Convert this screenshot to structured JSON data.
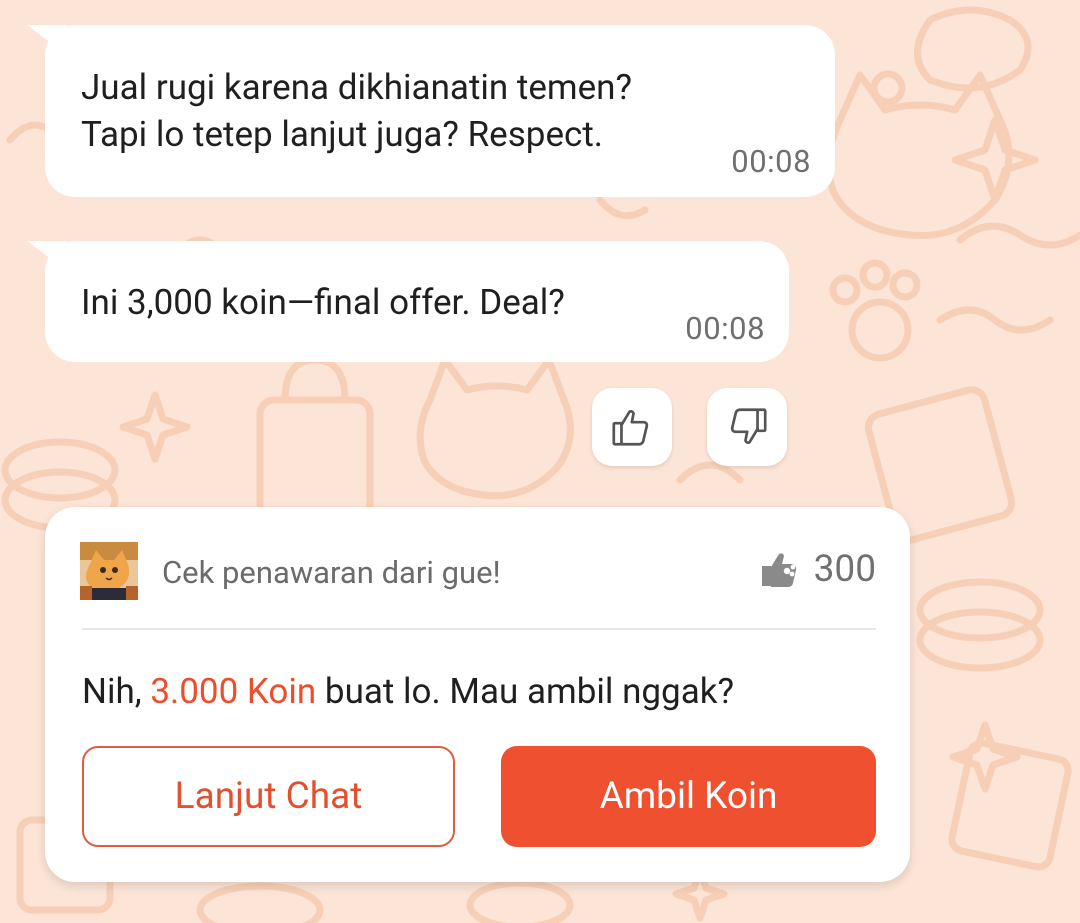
{
  "messages": [
    {
      "text": "Jual rugi karena dikhianatin temen?\nTapi lo tetep lanjut juga? Respect.",
      "time": "00:08"
    },
    {
      "text": "Ini 3,000 koin—final offer. Deal?",
      "time": "00:08"
    }
  ],
  "feedback": {
    "like_icon": "thumbs-up-icon",
    "dislike_icon": "thumbs-down-icon"
  },
  "offer_card": {
    "header": "Cek penawaran dari gue!",
    "count": "300",
    "message_prefix": "Nih, ",
    "message_highlight": "3.000 Koin",
    "message_suffix": " buat lo. Mau ambil nggak?",
    "secondary_button": "Lanjut Chat",
    "primary_button": "Ambil Koin"
  },
  "colors": {
    "background": "#fce4d6",
    "accent": "#ee4d2d",
    "primary_button": "#ef5030"
  }
}
